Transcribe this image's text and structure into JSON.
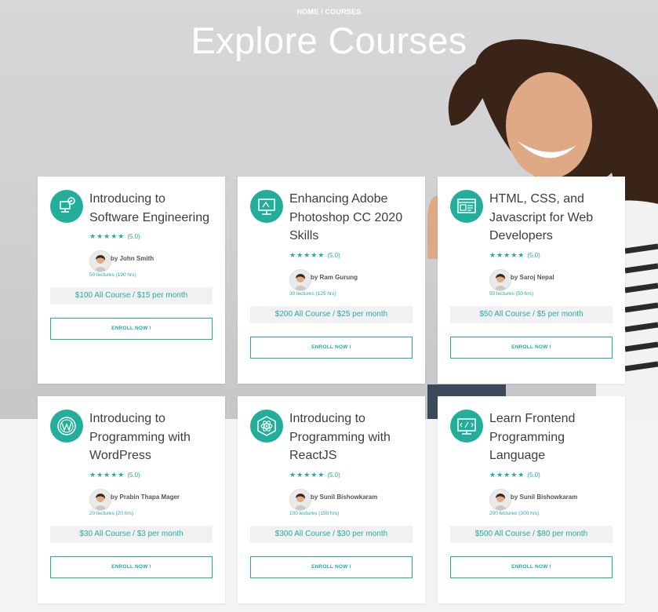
{
  "header": {
    "breadcrumb": "HOME / COURSES",
    "title": "Explore Courses"
  },
  "colors": {
    "accent": "#23ad9b",
    "price_bg": "#f1f1f1"
  },
  "courses": [
    {
      "title_lines": [
        "Introducing to",
        "Software Engineering"
      ],
      "icon": "computer-gear-icon",
      "stars": "★★★★★",
      "rating": "(5.0)",
      "instructor": "by John Smith",
      "lectures": "50 lectures (190 hrs)",
      "price": "$100 All Course / $15 per month",
      "cta": "ENROLL NOW !"
    },
    {
      "title_lines": [
        "Enhancing Adobe",
        "Photoshop CC 2020",
        "Skills"
      ],
      "icon": "design-board-icon",
      "stars": "★★★★★",
      "rating": "(5.0)",
      "instructor": "by Ram Gurung",
      "lectures": "30 lectures (125 hrs)",
      "price": "$200 All Course / $25 per month",
      "cta": "ENROLL NOW !"
    },
    {
      "title_lines": [
        "HTML, CSS, and",
        "Javascript for Web",
        "Developers"
      ],
      "icon": "web-layout-icon",
      "stars": "★★★★★",
      "rating": "(5.0)",
      "instructor": "by Saroj Nepal",
      "lectures": "50 lectures (50 hrs)",
      "price": "$50 All Course / $5 per month",
      "cta": "ENROLL NOW !"
    },
    {
      "title_lines": [
        "Introducing to",
        "Programming with",
        "WordPress"
      ],
      "icon": "wordpress-icon",
      "stars": "★★★★★",
      "rating": "(5.0)",
      "instructor": "by Prabin Thapa Mager",
      "lectures": "20 lectures (20 hrs)",
      "price": "$30 All Course / $3 per month",
      "cta": "ENROLL NOW !"
    },
    {
      "title_lines": [
        "Introducing to",
        "Programming with",
        "ReactJS"
      ],
      "icon": "react-icon",
      "stars": "★★★★★",
      "rating": "(5.0)",
      "instructor": "by Sunil Bishowkaram",
      "lectures": "100 lectures (150 hrs)",
      "price": "$300 All Course / $30 per month",
      "cta": "ENROLL NOW !"
    },
    {
      "title_lines": [
        "Learn Frontend",
        "Programming",
        "Language"
      ],
      "icon": "code-monitor-icon",
      "stars": "★★★★★",
      "rating": "(5.0)",
      "instructor": "by Sunil Bishowkaram",
      "lectures": "200 lectures (300 hrs)",
      "price": "$500 All Course / $80 per month",
      "cta": "ENROLL NOW !"
    }
  ]
}
